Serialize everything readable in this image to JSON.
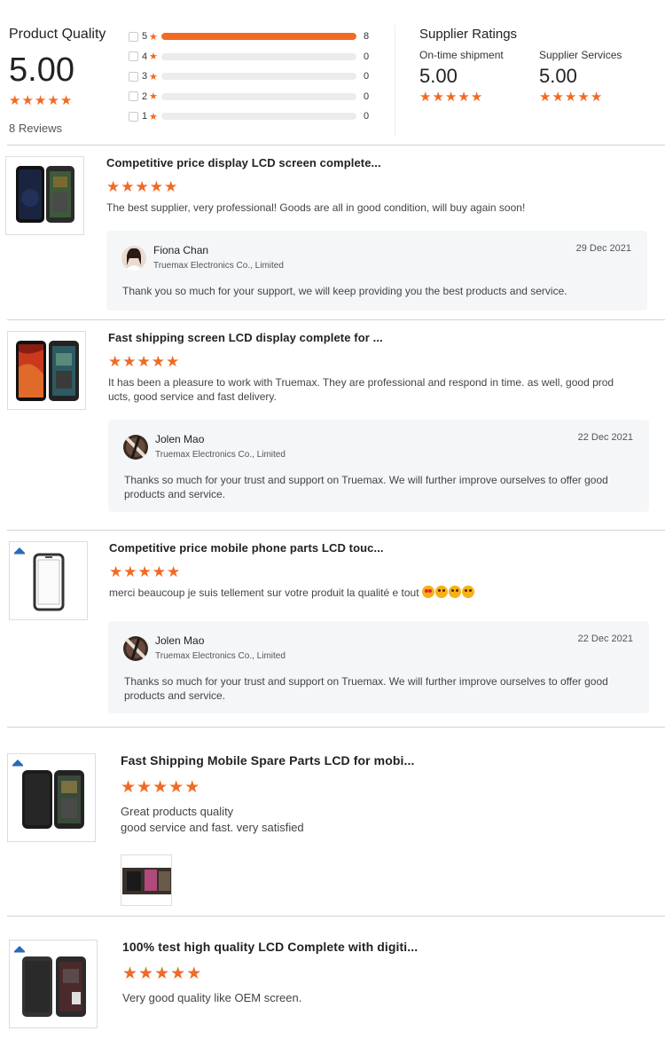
{
  "summary": {
    "product_quality_label": "Product Quality",
    "product_quality_score": "5.00",
    "product_quality_rating": 5,
    "reviews_count_label": "8 Reviews",
    "distribution": [
      {
        "star": "5",
        "count": "8",
        "fraction": 1.0
      },
      {
        "star": "4",
        "count": "0",
        "fraction": 0
      },
      {
        "star": "3",
        "count": "0",
        "fraction": 0
      },
      {
        "star": "2",
        "count": "0",
        "fraction": 0
      },
      {
        "star": "1",
        "count": "0",
        "fraction": 0
      }
    ],
    "supplier_ratings_label": "Supplier Ratings",
    "on_time": {
      "label": "On-time shipment",
      "score": "5.00",
      "rating": 5
    },
    "services": {
      "label": "Supplier Services",
      "score": "5.00",
      "rating": 5
    }
  },
  "reviews": [
    {
      "title": "Competitive price display LCD screen complete...",
      "rating": 5,
      "text": "The best supplier, very professional! Goods are all in good condition, will buy again soon!",
      "reply": {
        "name": "Fiona Chan",
        "company": "Truemax Electronics Co., Limited",
        "date": "29 Dec 2021",
        "text": "Thank you so much for your support, we will keep providing you the best products and service."
      }
    },
    {
      "title": "Fast shipping screen LCD display complete for ...",
      "rating": 5,
      "text_line1": "It has been a pleasure to work with Truemax. They are professional and respond in time. as well, good prod",
      "text_line2": "ucts, good service and fast delivery.",
      "reply": {
        "name": "Jolen Mao",
        "company": "Truemax Electronics Co., Limited",
        "date": "22 Dec 2021",
        "text_line1": "Thanks so much for your trust and support on Truemax. We will further improve ourselves to offer good",
        "text_line2": "products and service."
      }
    },
    {
      "title": "Competitive price mobile phone parts LCD touc...",
      "rating": 5,
      "text": "merci beaucoup je suis tellement sur votre produit la qualité e tout",
      "text_trailing": " ",
      "reply": {
        "name": "Jolen Mao",
        "company": "Truemax Electronics Co., Limited",
        "date": "22 Dec 2021",
        "text_line1": "Thanks so much for your trust and support on Truemax. We will further improve ourselves to offer good",
        "text_line2": "products and service."
      }
    },
    {
      "title": "Fast Shipping Mobile Spare Parts LCD for mobi...",
      "rating": 5,
      "text_line1": "Great products quality",
      "text_line2": "good service and fast. very satisfied"
    },
    {
      "title": "100% test high quality LCD Complete with digiti...",
      "rating": 5,
      "text": "Very good quality like OEM screen."
    }
  ],
  "icons": {
    "star": "star-icon",
    "checkbox": "checkbox-icon"
  },
  "colors": {
    "accent": "#f16a24",
    "reply_bg": "#f5f6f8"
  }
}
